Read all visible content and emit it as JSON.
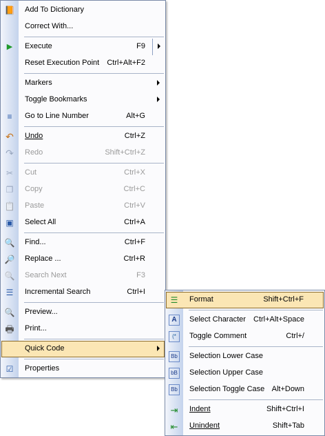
{
  "main_menu": {
    "items": [
      {
        "label": "Add To Dictionary",
        "shortcut": "",
        "icon": "book-icon",
        "disabled": false,
        "submenu": false
      },
      {
        "label": "Correct With...",
        "shortcut": "",
        "icon": "",
        "disabled": false,
        "submenu": false
      },
      {
        "label": "Execute",
        "shortcut": "F9",
        "icon": "play-icon",
        "disabled": false,
        "submenu": true
      },
      {
        "label": "Reset Execution Point",
        "shortcut": "Ctrl+Alt+F2",
        "icon": "",
        "disabled": false,
        "submenu": false
      },
      {
        "label": "Markers",
        "shortcut": "",
        "icon": "",
        "disabled": false,
        "submenu": true
      },
      {
        "label": "Toggle Bookmarks",
        "shortcut": "",
        "icon": "",
        "disabled": false,
        "submenu": true
      },
      {
        "label": "Go to Line Number",
        "shortcut": "Alt+G",
        "icon": "goto-line-icon",
        "disabled": false,
        "submenu": false
      },
      {
        "label": "Undo",
        "shortcut": "Ctrl+Z",
        "icon": "undo-icon",
        "disabled": false,
        "submenu": false
      },
      {
        "label": "Redo",
        "shortcut": "Shift+Ctrl+Z",
        "icon": "redo-icon",
        "disabled": true,
        "submenu": false
      },
      {
        "label": "Cut",
        "shortcut": "Ctrl+X",
        "icon": "scissors-icon",
        "disabled": true,
        "submenu": false
      },
      {
        "label": "Copy",
        "shortcut": "Ctrl+C",
        "icon": "copy-icon",
        "disabled": true,
        "submenu": false
      },
      {
        "label": "Paste",
        "shortcut": "Ctrl+V",
        "icon": "paste-icon",
        "disabled": true,
        "submenu": false
      },
      {
        "label": "Select All",
        "shortcut": "Ctrl+A",
        "icon": "select-all-icon",
        "disabled": false,
        "submenu": false
      },
      {
        "label": "Find...",
        "shortcut": "Ctrl+F",
        "icon": "find-icon",
        "disabled": false,
        "submenu": false
      },
      {
        "label": "Replace ...",
        "shortcut": "Ctrl+R",
        "icon": "replace-icon",
        "disabled": false,
        "submenu": false
      },
      {
        "label": "Search Next",
        "shortcut": "F3",
        "icon": "search-next-icon",
        "disabled": true,
        "submenu": false
      },
      {
        "label": "Incremental Search",
        "shortcut": "Ctrl+I",
        "icon": "incremental-search-icon",
        "disabled": false,
        "submenu": false
      },
      {
        "label": "Preview...",
        "shortcut": "",
        "icon": "preview-icon",
        "disabled": false,
        "submenu": false
      },
      {
        "label": "Print...",
        "shortcut": "",
        "icon": "printer-icon",
        "disabled": false,
        "submenu": false
      },
      {
        "label": "Quick Code",
        "shortcut": "",
        "icon": "",
        "disabled": false,
        "submenu": true,
        "highlighted": true
      },
      {
        "label": "Properties",
        "shortcut": "",
        "icon": "properties-icon",
        "disabled": false,
        "submenu": false
      }
    ]
  },
  "quick_code_menu": {
    "items": [
      {
        "label": "Format",
        "shortcut": "Shift+Ctrl+F",
        "icon": "format-icon",
        "highlighted": true
      },
      {
        "label": "Select Character",
        "shortcut": "Ctrl+Alt+Space",
        "icon": "select-character-icon"
      },
      {
        "label": "Toggle Comment",
        "shortcut": "Ctrl+/",
        "icon": "toggle-comment-icon"
      },
      {
        "label": "Selection Lower Case",
        "shortcut": "",
        "icon": "lower-case-icon"
      },
      {
        "label": "Selection Upper Case",
        "shortcut": "",
        "icon": "upper-case-icon"
      },
      {
        "label": "Selection Toggle Case",
        "shortcut": "Alt+Down",
        "icon": "toggle-case-icon"
      },
      {
        "label": "Indent",
        "shortcut": "Shift+Ctrl+I",
        "icon": "indent-icon"
      },
      {
        "label": "Unindent",
        "shortcut": "Shift+Tab",
        "icon": "unindent-icon"
      }
    ]
  },
  "icon_glyphs": {
    "book": "📙",
    "play": "▶",
    "goto": "≡",
    "undo": "↶",
    "redo": "↷",
    "scissors": "✂",
    "copy": "❐",
    "paste": "📋",
    "select_all": "▣",
    "find": "🔍",
    "replace": "🔎",
    "search_next": "🔍",
    "incremental": "☰",
    "preview": "🔍",
    "printer": "🖶",
    "properties": "☑",
    "format": "☰",
    "select_char": "A",
    "comment": "(*",
    "lower": "Bb",
    "upper": "bB",
    "toggle": "Bb",
    "indent": "⇥",
    "unindent": "⇤"
  },
  "colors": {
    "highlight_bg": "#fbe6b4",
    "highlight_border": "#8a6a2a",
    "gutter_start": "#f2f5fb",
    "gutter_end": "#c4d3ec",
    "disabled_text": "#9a9a9a"
  }
}
